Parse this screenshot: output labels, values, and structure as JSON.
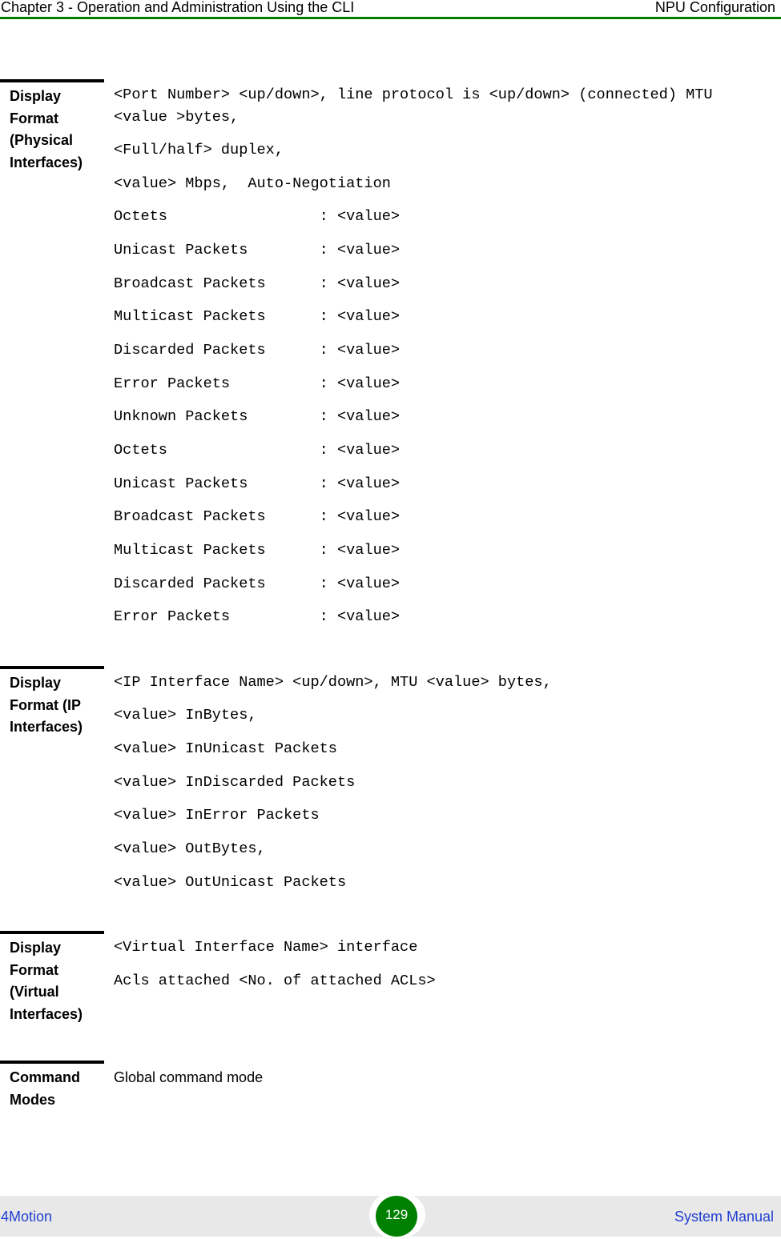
{
  "header": {
    "chapter": "Chapter 3 - Operation and Administration Using the CLI",
    "section": "NPU Configuration",
    "rule_color": "#008000"
  },
  "sections": {
    "physical": {
      "label": [
        "Display",
        "Format",
        "(Physical",
        "Interfaces)"
      ],
      "lines": [
        "<Port Number> <up/down>, line protocol is <up/down> (connected) MTU",
        "<value >bytes,",
        "<Full/half> duplex,",
        "<value> Mbps,  Auto-Negotiation",
        "Octets                 : <value>",
        "Unicast Packets        : <value>",
        "Broadcast Packets      : <value>",
        "Multicast Packets      : <value>",
        "Discarded Packets      : <value>",
        "Error Packets          : <value>",
        "Unknown Packets        : <value>",
        "Octets                 : <value>",
        "Unicast Packets        : <value>",
        "Broadcast Packets      : <value>",
        "Multicast Packets      : <value>",
        "Discarded Packets      : <value>",
        "Error Packets          : <value>"
      ]
    },
    "ip": {
      "label": [
        "Display",
        "Format (IP",
        "Interfaces)"
      ],
      "lines": [
        "<IP Interface Name> <up/down>, MTU <value> bytes,",
        "<value> InBytes,",
        "<value> InUnicast Packets",
        "<value> InDiscarded Packets",
        "<value> InError Packets",
        "<value> OutBytes,",
        "<value> OutUnicast Packets"
      ]
    },
    "virtual": {
      "label": [
        "Display",
        "Format",
        "(Virtual",
        "Interfaces)"
      ],
      "lines": [
        "<Virtual Interface Name> interface",
        "Acls attached <No. of attached ACLs>"
      ]
    },
    "command_modes": {
      "label": [
        "Command",
        "Modes"
      ],
      "text": "Global command mode"
    }
  },
  "footer": {
    "product": "4Motion",
    "page_number": "129",
    "doc_title": "System Manual",
    "badge_color": "#008000",
    "link_color": "#1f3fd0"
  }
}
